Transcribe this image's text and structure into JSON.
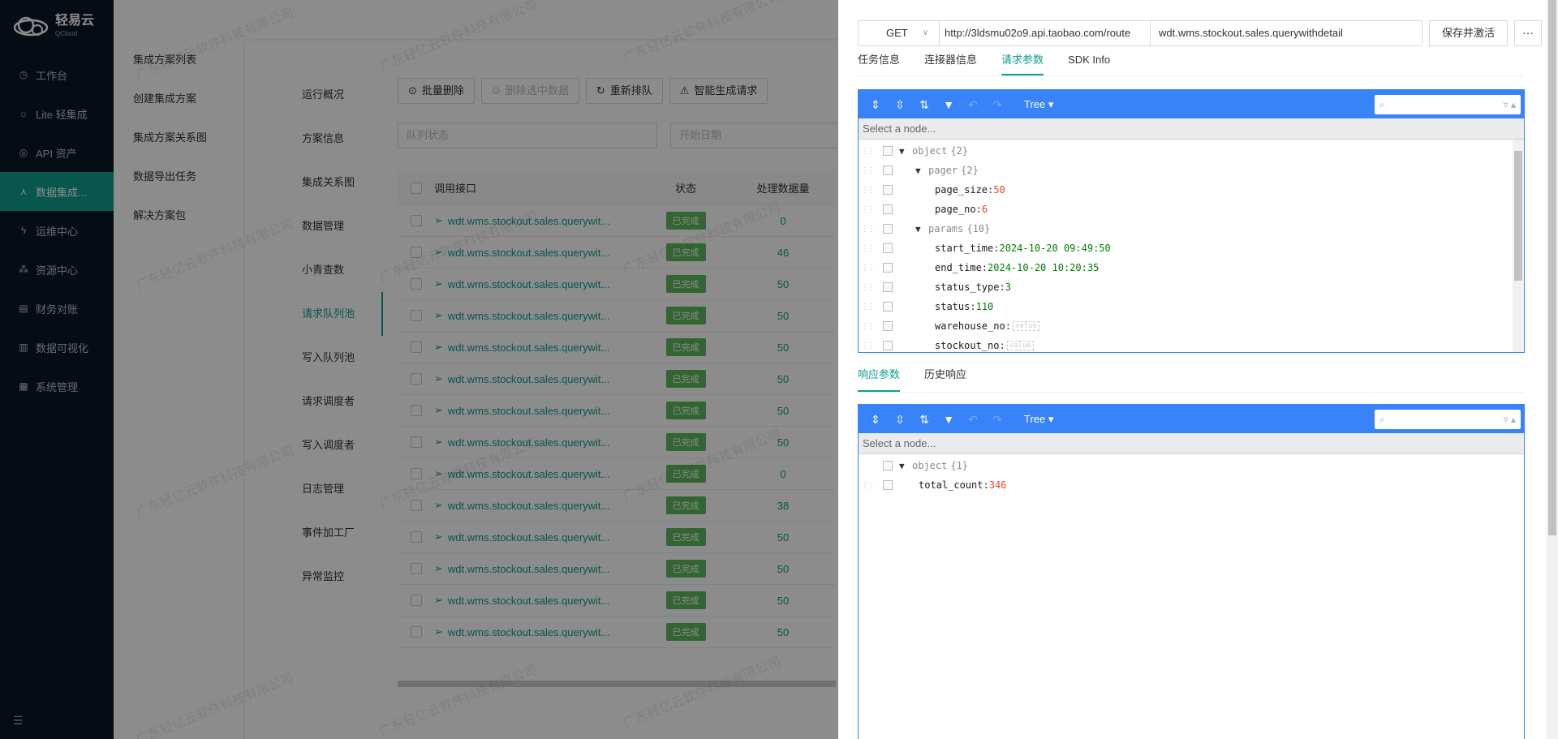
{
  "brand": {
    "name": "轻易云",
    "sub": "QCloud"
  },
  "nav": {
    "items": [
      {
        "icon": "workbench-icon",
        "glyph": "◷",
        "label": "工作台"
      },
      {
        "icon": "bulb-icon",
        "glyph": "☼",
        "label": "Lite 轻集成"
      },
      {
        "icon": "compass-icon",
        "glyph": "◎",
        "label": "API 资产"
      },
      {
        "icon": "flow-icon",
        "glyph": "⋏",
        "label": "数据集成...",
        "active": true
      },
      {
        "icon": "bolt-icon",
        "glyph": "ϟ",
        "label": "运维中心"
      },
      {
        "icon": "cluster-icon",
        "glyph": "⁂",
        "label": "资源中心"
      },
      {
        "icon": "ledger-icon",
        "glyph": "▤",
        "label": "财务对账"
      },
      {
        "icon": "chart-icon",
        "glyph": "▥",
        "label": "数据可视化"
      },
      {
        "icon": "system-icon",
        "glyph": "▦",
        "label": "系统管理"
      }
    ]
  },
  "submenu": [
    "集成方案列表",
    "创建集成方案",
    "集成方案关系图",
    "数据导出任务",
    "解决方案包"
  ],
  "steps": [
    "运行概况",
    "方案信息",
    "集成关系图",
    "数据管理",
    "小青查数",
    "请求队列池",
    "写入队列池",
    "请求调度者",
    "写入调度者",
    "日志管理",
    "事件加工厂",
    "异常监控"
  ],
  "toolbar": {
    "batch_delete": "批量删除",
    "delete_selected": "删除选中数据",
    "requeue": "重新排队",
    "smart_generate": "智能生成请求"
  },
  "filters": {
    "queue_status": "队列状态",
    "start_date": "开始日期"
  },
  "table": {
    "headers": {
      "api": "调用接口",
      "status": "状态",
      "count": "处理数据量"
    },
    "rows": [
      {
        "api": "wdt.wms.stockout.sales.querywit...",
        "status": "已完成",
        "count": "0"
      },
      {
        "api": "wdt.wms.stockout.sales.querywit...",
        "status": "已完成",
        "count": "46"
      },
      {
        "api": "wdt.wms.stockout.sales.querywit...",
        "status": "已完成",
        "count": "50"
      },
      {
        "api": "wdt.wms.stockout.sales.querywit...",
        "status": "已完成",
        "count": "50"
      },
      {
        "api": "wdt.wms.stockout.sales.querywit...",
        "status": "已完成",
        "count": "50"
      },
      {
        "api": "wdt.wms.stockout.sales.querywit...",
        "status": "已完成",
        "count": "50"
      },
      {
        "api": "wdt.wms.stockout.sales.querywit...",
        "status": "已完成",
        "count": "50"
      },
      {
        "api": "wdt.wms.stockout.sales.querywit...",
        "status": "已完成",
        "count": "50"
      },
      {
        "api": "wdt.wms.stockout.sales.querywit...",
        "status": "已完成",
        "count": "0"
      },
      {
        "api": "wdt.wms.stockout.sales.querywit...",
        "status": "已完成",
        "count": "38"
      },
      {
        "api": "wdt.wms.stockout.sales.querywit...",
        "status": "已完成",
        "count": "50"
      },
      {
        "api": "wdt.wms.stockout.sales.querywit...",
        "status": "已完成",
        "count": "50"
      },
      {
        "api": "wdt.wms.stockout.sales.querywit...",
        "status": "已完成",
        "count": "50"
      },
      {
        "api": "wdt.wms.stockout.sales.querywit...",
        "status": "已完成",
        "count": "50"
      }
    ]
  },
  "watermark": "广东轻亿云软件科技有限公司",
  "drawer": {
    "method": "GET",
    "url": "http://3ldsmu02o9.api.taobao.com/route",
    "operation": "wdt.wms.stockout.sales.querywithdetail",
    "save_label": "保存并激活",
    "more_label": "···",
    "tabs": [
      "任务信息",
      "连接器信息",
      "请求参数",
      "SDK Info"
    ],
    "active_tab": 2,
    "resp_tabs": [
      "响应参数",
      "历史响应"
    ],
    "editor": {
      "mode": "Tree",
      "nav_placeholder": "Select a node..."
    },
    "request_tree": [
      {
        "indent": 0,
        "toggle": "▼",
        "key": "object",
        "type": "{2}"
      },
      {
        "indent": 1,
        "toggle": "▼",
        "key": "pager",
        "type": "{2}"
      },
      {
        "indent": 2,
        "key": "page_size",
        "value": "50",
        "vtype": "num"
      },
      {
        "indent": 2,
        "key": "page_no",
        "value": "6",
        "vtype": "num"
      },
      {
        "indent": 1,
        "toggle": "▼",
        "key": "params",
        "type": "{10}"
      },
      {
        "indent": 2,
        "key": "start_time",
        "value": "2024-10-20 09:49:50",
        "vtype": "str"
      },
      {
        "indent": 2,
        "key": "end_time",
        "value": "2024-10-20 10:20:35",
        "vtype": "str"
      },
      {
        "indent": 2,
        "key": "status_type",
        "value": "3",
        "vtype": "str"
      },
      {
        "indent": 2,
        "key": "status",
        "value": "110",
        "vtype": "str"
      },
      {
        "indent": 2,
        "key": "warehouse_no",
        "value": "value",
        "vtype": "empty"
      },
      {
        "indent": 2,
        "key": "stockout_no",
        "value": "value",
        "vtype": "empty"
      }
    ],
    "response_tree": [
      {
        "indent": 0,
        "toggle": "▼",
        "key": "object",
        "type": "{1}"
      },
      {
        "indent": 1,
        "key": "total_count",
        "value": "346",
        "vtype": "num"
      }
    ]
  },
  "colors": {
    "accent": "#0f9d8f",
    "editor_blue": "#3883fa",
    "nav_bg": "#0b1624",
    "badge_green": "#5cb85c"
  }
}
